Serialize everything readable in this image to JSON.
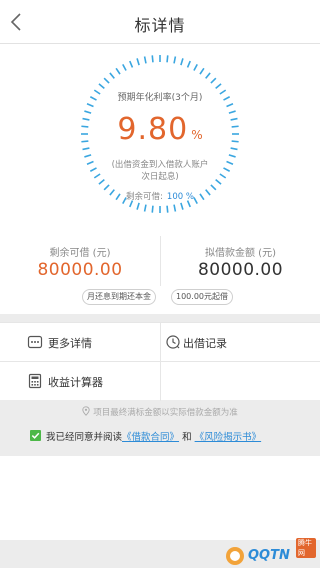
{
  "header": {
    "title": "标详情",
    "back_icon": "back-arrow-icon"
  },
  "hero": {
    "rate_label": "预期年化利率(3个月)",
    "rate_value": "9.80",
    "rate_unit": "%",
    "note_line1": "(出借资金到入借款人账户",
    "note_line2": "次日起息)",
    "remaining_label": "剩余可借:",
    "remaining_value": "100 %",
    "accent": "#e2662d",
    "ring_color": "#3aa6e0"
  },
  "amounts": {
    "left_label": "剩余可借 (元)",
    "left_value": "80000.00",
    "right_label": "拟借款金额 (元)",
    "right_value": "80000.00",
    "chip_repay": "月还息到期还本金",
    "chip_min": "100.00元起借"
  },
  "menu": {
    "more_details": "更多详情",
    "records": "出借记录",
    "calculator": "收益计算器",
    "icons": [
      "more-dots-icon",
      "clock-record-icon",
      "calculator-icon"
    ]
  },
  "tip": {
    "text": "项目最终满标金额以实际借款金额为准",
    "icon": "location-pin-icon"
  },
  "agreement": {
    "prefix": "我已经同意并阅读",
    "contract_link": "《借款合同》",
    "and": "和",
    "risk_link": "《风险揭示书》",
    "checked": true,
    "check_color": "#4cb848"
  },
  "watermark": {
    "text": "QQTN",
    "sub": "腾牛网"
  }
}
